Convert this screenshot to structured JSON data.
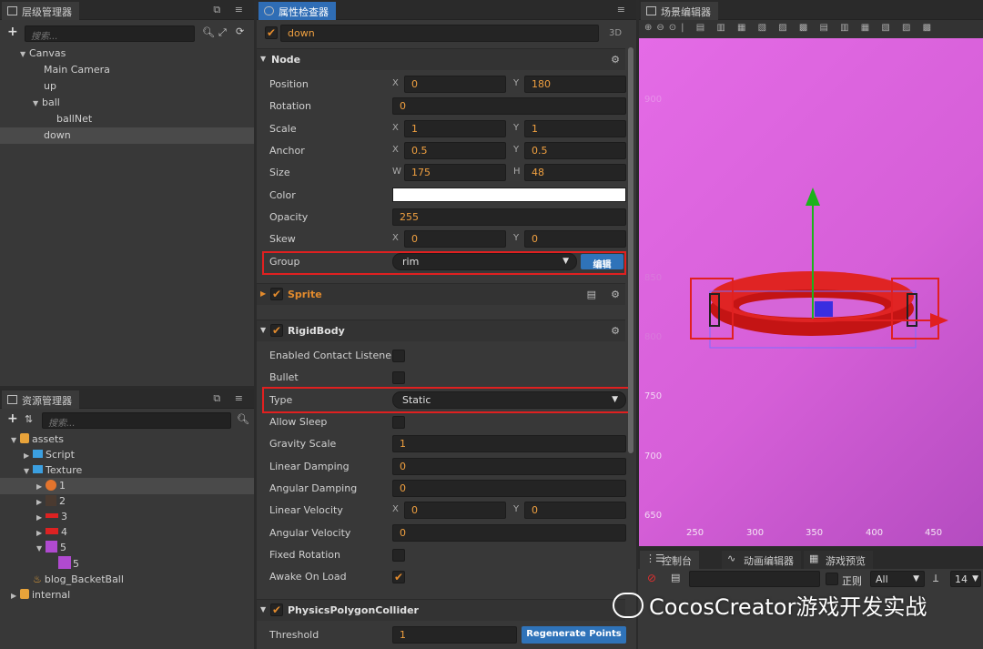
{
  "hierarchy": {
    "title": "层级管理器",
    "search_placeholder": "搜索...",
    "nodes": [
      {
        "label": "Canvas"
      },
      {
        "label": "Main Camera"
      },
      {
        "label": "up"
      },
      {
        "label": "ball"
      },
      {
        "label": "ballNet"
      },
      {
        "label": "down"
      }
    ]
  },
  "assets": {
    "title": "资源管理器",
    "search_placeholder": "搜索...",
    "items": [
      {
        "label": "assets"
      },
      {
        "label": "Script"
      },
      {
        "label": "Texture"
      },
      {
        "label": "1"
      },
      {
        "label": "2"
      },
      {
        "label": "3"
      },
      {
        "label": "4"
      },
      {
        "label": "5"
      },
      {
        "label": "5"
      },
      {
        "label": "blog_BacketBall"
      },
      {
        "label": "internal"
      }
    ]
  },
  "inspector": {
    "title": "属性检查器",
    "node_name": "down",
    "mode_3d": "3D",
    "node_section": "Node",
    "position": {
      "label": "Position",
      "x_axis": "X",
      "x": "0",
      "y_axis": "Y",
      "y": "180"
    },
    "rotation": {
      "label": "Rotation",
      "value": "0"
    },
    "scale": {
      "label": "Scale",
      "x_axis": "X",
      "x": "1",
      "y_axis": "Y",
      "y": "1"
    },
    "anchor": {
      "label": "Anchor",
      "x_axis": "X",
      "x": "0.5",
      "y_axis": "Y",
      "y": "0.5"
    },
    "size": {
      "label": "Size",
      "x_axis": "W",
      "x": "175",
      "y_axis": "H",
      "y": "48"
    },
    "color": {
      "label": "Color",
      "value_hex": "#ffffff"
    },
    "opacity": {
      "label": "Opacity",
      "value": "255"
    },
    "skew": {
      "label": "Skew",
      "x_axis": "X",
      "x": "0",
      "y_axis": "Y",
      "y": "0"
    },
    "group": {
      "label": "Group",
      "value": "rim",
      "edit_button": "编辑"
    },
    "sprite_section": "Sprite",
    "rigidbody_section": "RigidBody",
    "enabled_contact_listener": {
      "label": "Enabled Contact Listener",
      "checked": false
    },
    "bullet": {
      "label": "Bullet",
      "checked": false
    },
    "type": {
      "label": "Type",
      "value": "Static"
    },
    "allow_sleep": {
      "label": "Allow Sleep",
      "checked": false
    },
    "gravity_scale": {
      "label": "Gravity Scale",
      "value": "1"
    },
    "linear_damping": {
      "label": "Linear Damping",
      "value": "0"
    },
    "angular_damping": {
      "label": "Angular Damping",
      "value": "0"
    },
    "linear_velocity": {
      "label": "Linear Velocity",
      "x_axis": "X",
      "x": "0",
      "y_axis": "Y",
      "y": "0"
    },
    "angular_velocity": {
      "label": "Angular Velocity",
      "value": "0"
    },
    "fixed_rotation": {
      "label": "Fixed Rotation",
      "checked": false
    },
    "awake_on_load": {
      "label": "Awake On Load",
      "checked": true
    },
    "collider_section": "PhysicsPolygonCollider",
    "threshold": {
      "label": "Threshold",
      "value": "1",
      "button": "Regenerate Points"
    }
  },
  "scene": {
    "title": "场景编辑器",
    "y_ticks": [
      "750",
      "700",
      "650"
    ],
    "x_ticks": [
      "250",
      "300",
      "350",
      "400",
      "450"
    ],
    "faint_y_ticks": [
      "900",
      "850",
      "800"
    ],
    "bg_color": "#e46be6"
  },
  "console": {
    "tabs": [
      "控制台",
      "动画编辑器",
      "游戏预览"
    ],
    "regex_label": "正则",
    "filter_value": "All",
    "font_size": "14"
  },
  "watermark": "CocosCreator游戏开发实战",
  "colors": {
    "accent": "#2f6db5",
    "value": "#f0a040",
    "highlight": "#e02020",
    "check": "#e38b2d"
  }
}
